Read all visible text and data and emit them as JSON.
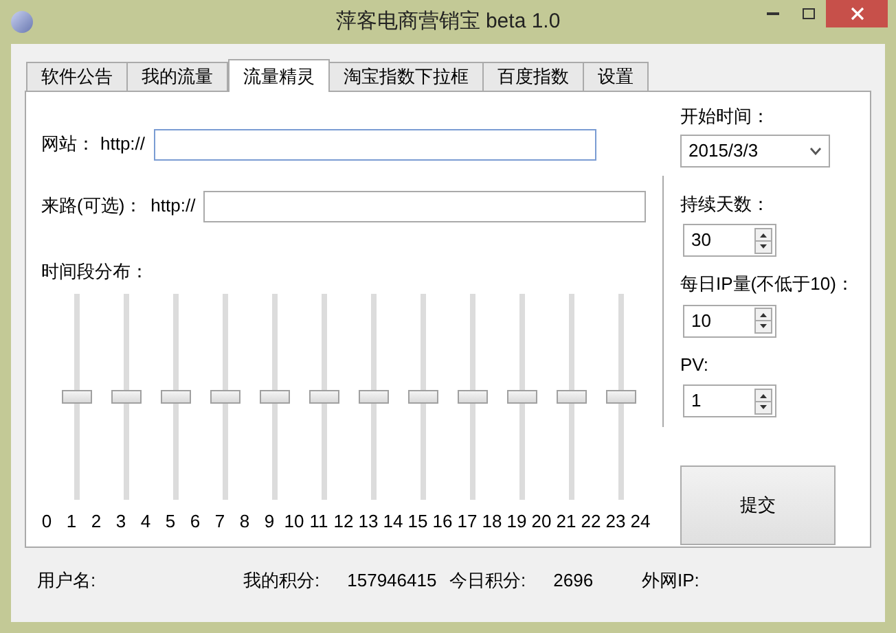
{
  "window": {
    "title": "萍客电商营销宝 beta 1.0"
  },
  "tabs": [
    {
      "label": "软件公告",
      "selected": false
    },
    {
      "label": "我的流量",
      "selected": false
    },
    {
      "label": "流量精灵",
      "selected": true
    },
    {
      "label": "淘宝指数下拉框",
      "selected": false
    },
    {
      "label": "百度指数",
      "selected": false
    },
    {
      "label": "设置",
      "selected": false
    }
  ],
  "site": {
    "label": "网站：",
    "prefix": "http://"
  },
  "referrer": {
    "label": "来路(可选)：",
    "prefix": "http://"
  },
  "distribution": {
    "label": "时间段分布：",
    "sliders": [
      {
        "level": 0.5
      },
      {
        "level": 0.5
      },
      {
        "level": 0.5
      },
      {
        "level": 0.5
      },
      {
        "level": 0.5
      },
      {
        "level": 0.5
      },
      {
        "level": 0.5
      },
      {
        "level": 0.5
      },
      {
        "level": 0.5
      },
      {
        "level": 0.5
      },
      {
        "level": 0.5
      },
      {
        "level": 0.5
      }
    ],
    "hours": [
      "0",
      "1",
      "2",
      "3",
      "4",
      "5",
      "6",
      "7",
      "8",
      "9",
      "10",
      "11",
      "12",
      "13",
      "14",
      "15",
      "16",
      "17",
      "18",
      "19",
      "20",
      "21",
      "22",
      "23",
      "24"
    ]
  },
  "start": {
    "label": "开始时间：",
    "value": "2015/3/3"
  },
  "spinners": [
    {
      "label": "持续天数：",
      "value": "30"
    },
    {
      "label": "每日IP量(不低于10)：",
      "value": "10"
    },
    {
      "label": "PV:",
      "value": "1"
    }
  ],
  "submit": "提交",
  "status": [
    {
      "label": "用户名:"
    },
    {
      "label": "我的积分:",
      "value": "157946415"
    },
    {
      "label": "今日积分:",
      "value": "2696"
    },
    {
      "label": "外网IP:"
    }
  ]
}
